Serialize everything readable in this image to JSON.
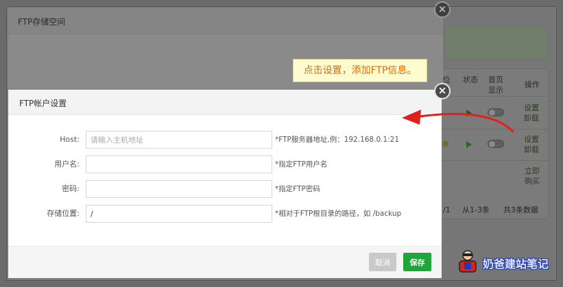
{
  "background": {
    "table_headers": {
      "position_partial": "位",
      "status": "状态",
      "homepage_display": "首页显示",
      "actions": "操作"
    },
    "rows": [
      {
        "action_set": "设置",
        "action_uninstall": "卸载"
      },
      {
        "action_set": "设置",
        "action_uninstall": "卸载"
      },
      {
        "action_buy_now": "立即购买"
      }
    ],
    "pagination": {
      "page_partial": "/1",
      "range": "从1-3条",
      "total": "共3条数据"
    }
  },
  "dialog_storage": {
    "title": "FTP存储空间"
  },
  "dialog_account": {
    "title": "FTP帐户设置",
    "fields": [
      {
        "label": "Host:",
        "value": "",
        "placeholder": "请输入主机地址",
        "hint": "*FTP服务器地址,例：192.168.0.1:21"
      },
      {
        "label": "用户名:",
        "value": "",
        "placeholder": "",
        "hint": "*指定FTP用户名"
      },
      {
        "label": "密码:",
        "value": "",
        "placeholder": "",
        "hint": "*指定FTP密码"
      },
      {
        "label": "存储位置:",
        "value": "/",
        "placeholder": "",
        "hint": "*相对于FTP根目录的路径，如 /backup"
      }
    ],
    "cancel_label": "取消",
    "save_label": "保存"
  },
  "tooltip": "点击设置，添加FTP信息。",
  "watermark": "奶爸建站笔记",
  "colors": {
    "save_green": "#20a53a",
    "tooltip_text": "#e36b00",
    "arrow_red": "#e0201a",
    "watermark_blue": "#1d3ab8"
  },
  "icons": {
    "close": "close-icon",
    "play": "play-icon",
    "toggle": "toggle-switch",
    "lock": "lock-icon"
  }
}
